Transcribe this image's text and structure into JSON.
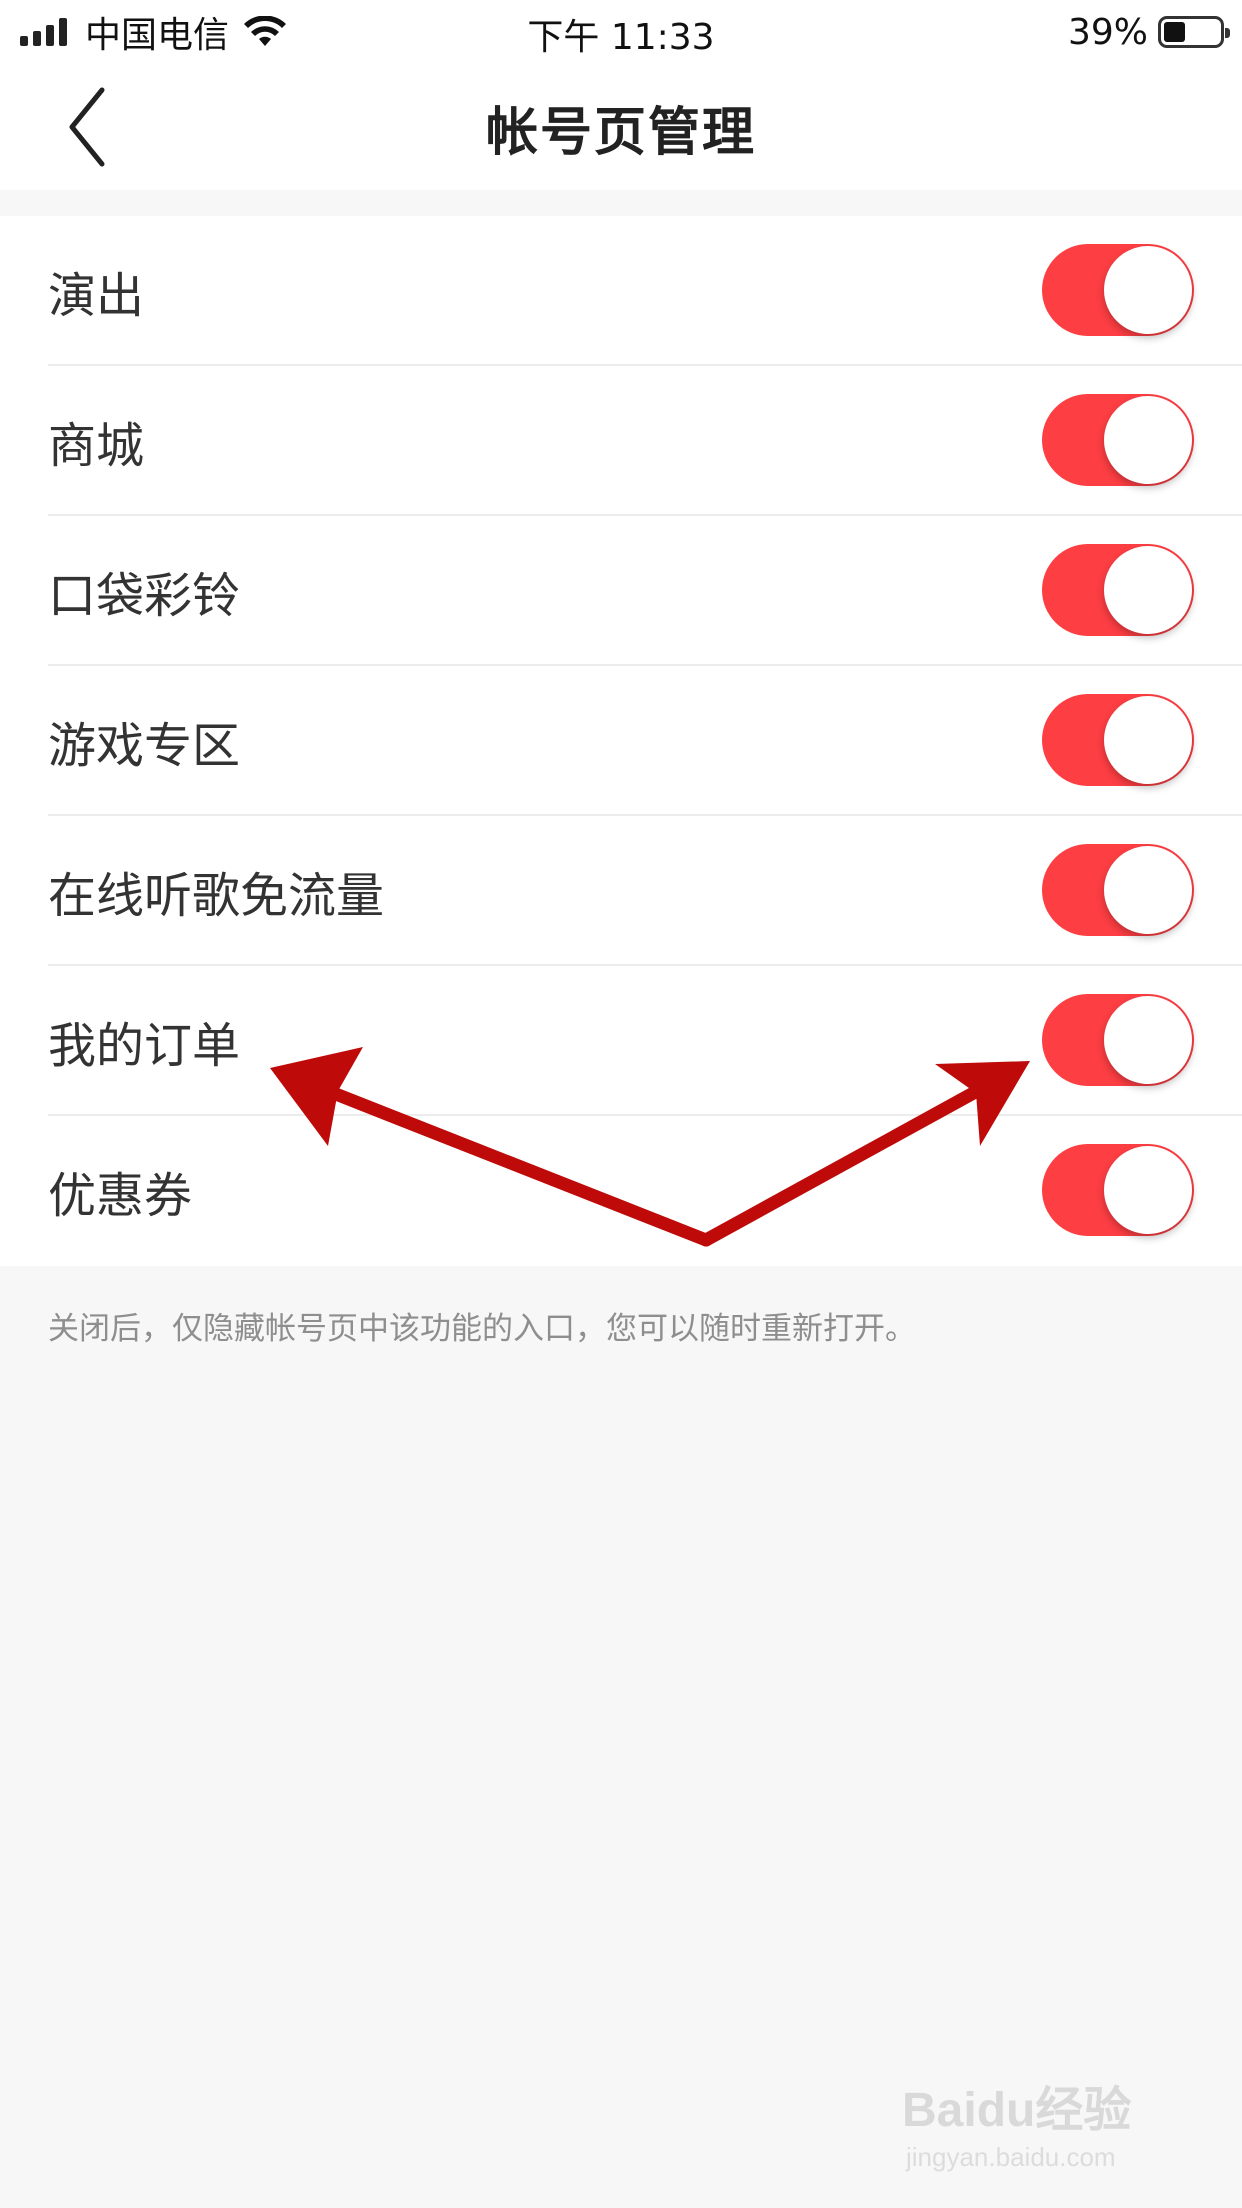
{
  "status_bar": {
    "carrier": "中国电信",
    "time": "下午 11:33",
    "battery_percent": "39%",
    "battery_level": 0.39,
    "icons": [
      "signal-icon",
      "wifi-icon",
      "battery-icon"
    ]
  },
  "nav": {
    "title": "帐号页管理",
    "back_icon": "chevron-left-icon"
  },
  "settings": {
    "items": [
      {
        "label": "演出",
        "enabled": true
      },
      {
        "label": "商城",
        "enabled": true
      },
      {
        "label": "口袋彩铃",
        "enabled": true
      },
      {
        "label": "游戏专区",
        "enabled": true
      },
      {
        "label": "在线听歌免流量",
        "enabled": true
      },
      {
        "label": "我的订单",
        "enabled": true
      },
      {
        "label": "优惠券",
        "enabled": true
      }
    ],
    "footnote": "关闭后，仅隐藏帐号页中该功能的入口，您可以随时重新打开。"
  },
  "colors": {
    "toggle_on": "#fd3e43",
    "annotation_arrow": "#bf0a0a",
    "background": "#f7f7f7"
  },
  "watermark": {
    "brand": "Baidu经验",
    "url": "jingyan.baidu.com"
  }
}
